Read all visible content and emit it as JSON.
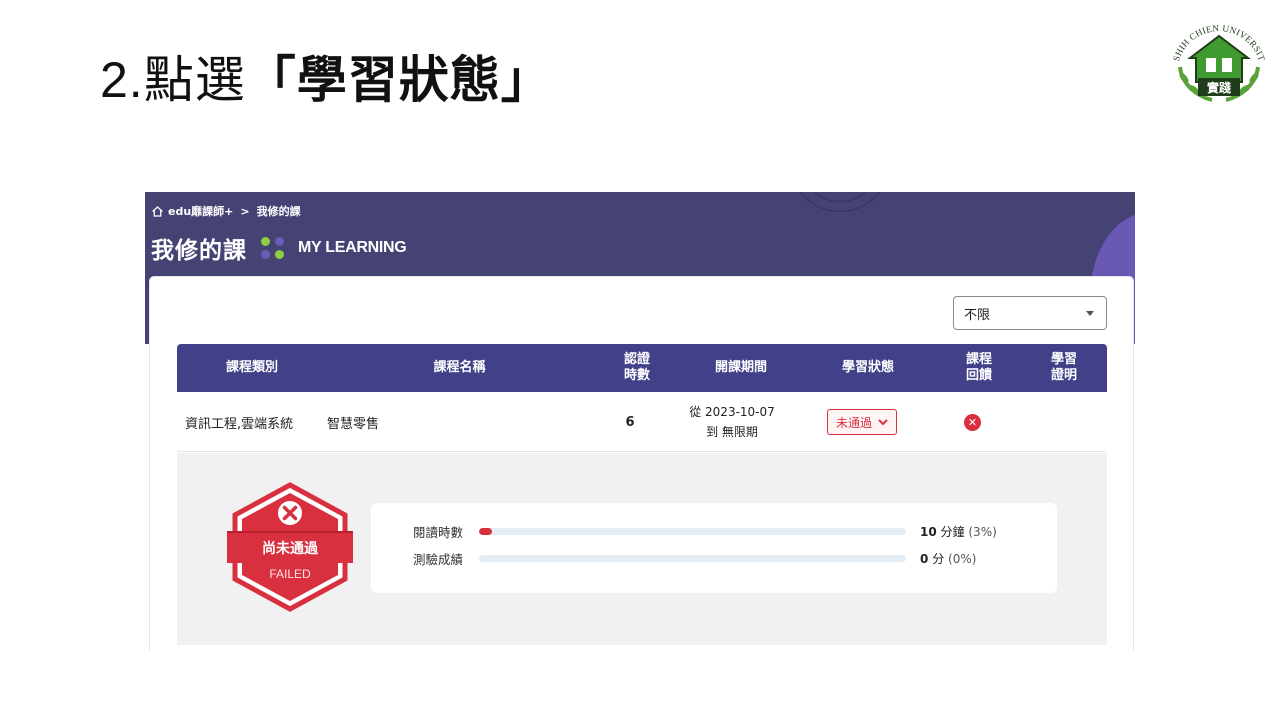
{
  "slide": {
    "step": "2.",
    "verb": "點選",
    "highlight": "「學習狀態」"
  },
  "logo": {
    "arc_text": "SHIH CHIEN UNIVERSITY",
    "plaque_text": "實踐",
    "colors": {
      "green": "#3f9a2f",
      "dark": "#1f3d1a",
      "leaf": "#5aa33a"
    }
  },
  "breadcrumb": {
    "home_icon": "home-icon",
    "site": "edu靡課師+",
    "separator": ">",
    "current": "我修的課"
  },
  "page": {
    "title_zh": "我修的課",
    "title_en": "MY LEARNING",
    "dot_colors": [
      "#8fcf3f",
      "#6d5bb8",
      "#6d5bb8",
      "#8fcf3f"
    ]
  },
  "filter": {
    "selected": "不限"
  },
  "table": {
    "headers": {
      "category": "課程類別",
      "name": "課程名稱",
      "hours_l1": "認證",
      "hours_l2": "時數",
      "period": "開課期間",
      "status": "學習狀態",
      "feedback_l1": "課程",
      "feedback_l2": "回饋",
      "cert_l1": "學習",
      "cert_l2": "證明"
    },
    "rows": [
      {
        "category": "資訊工程,雲端系統",
        "name": "智慧零售",
        "hours": "6",
        "period_from": "從 2023-10-07",
        "period_to": "到 無限期",
        "status": "未通過",
        "feedback_icon": "x-circle-icon"
      }
    ]
  },
  "detail": {
    "badge": {
      "zh": "尚未通過",
      "en": "FAILED",
      "color": "#d9303f"
    },
    "progress": [
      {
        "label": "閱讀時數",
        "value_bold": "10",
        "value_unit": "分鐘",
        "value_pct": "(3%)",
        "fraction": 0.03
      },
      {
        "label": "測驗成績",
        "value_bold": "0",
        "value_unit": "分",
        "value_pct": "(0%)",
        "fraction": 0
      }
    ]
  },
  "colors": {
    "banner": "#454374",
    "table_header": "#414088",
    "danger": "#d9303f"
  }
}
